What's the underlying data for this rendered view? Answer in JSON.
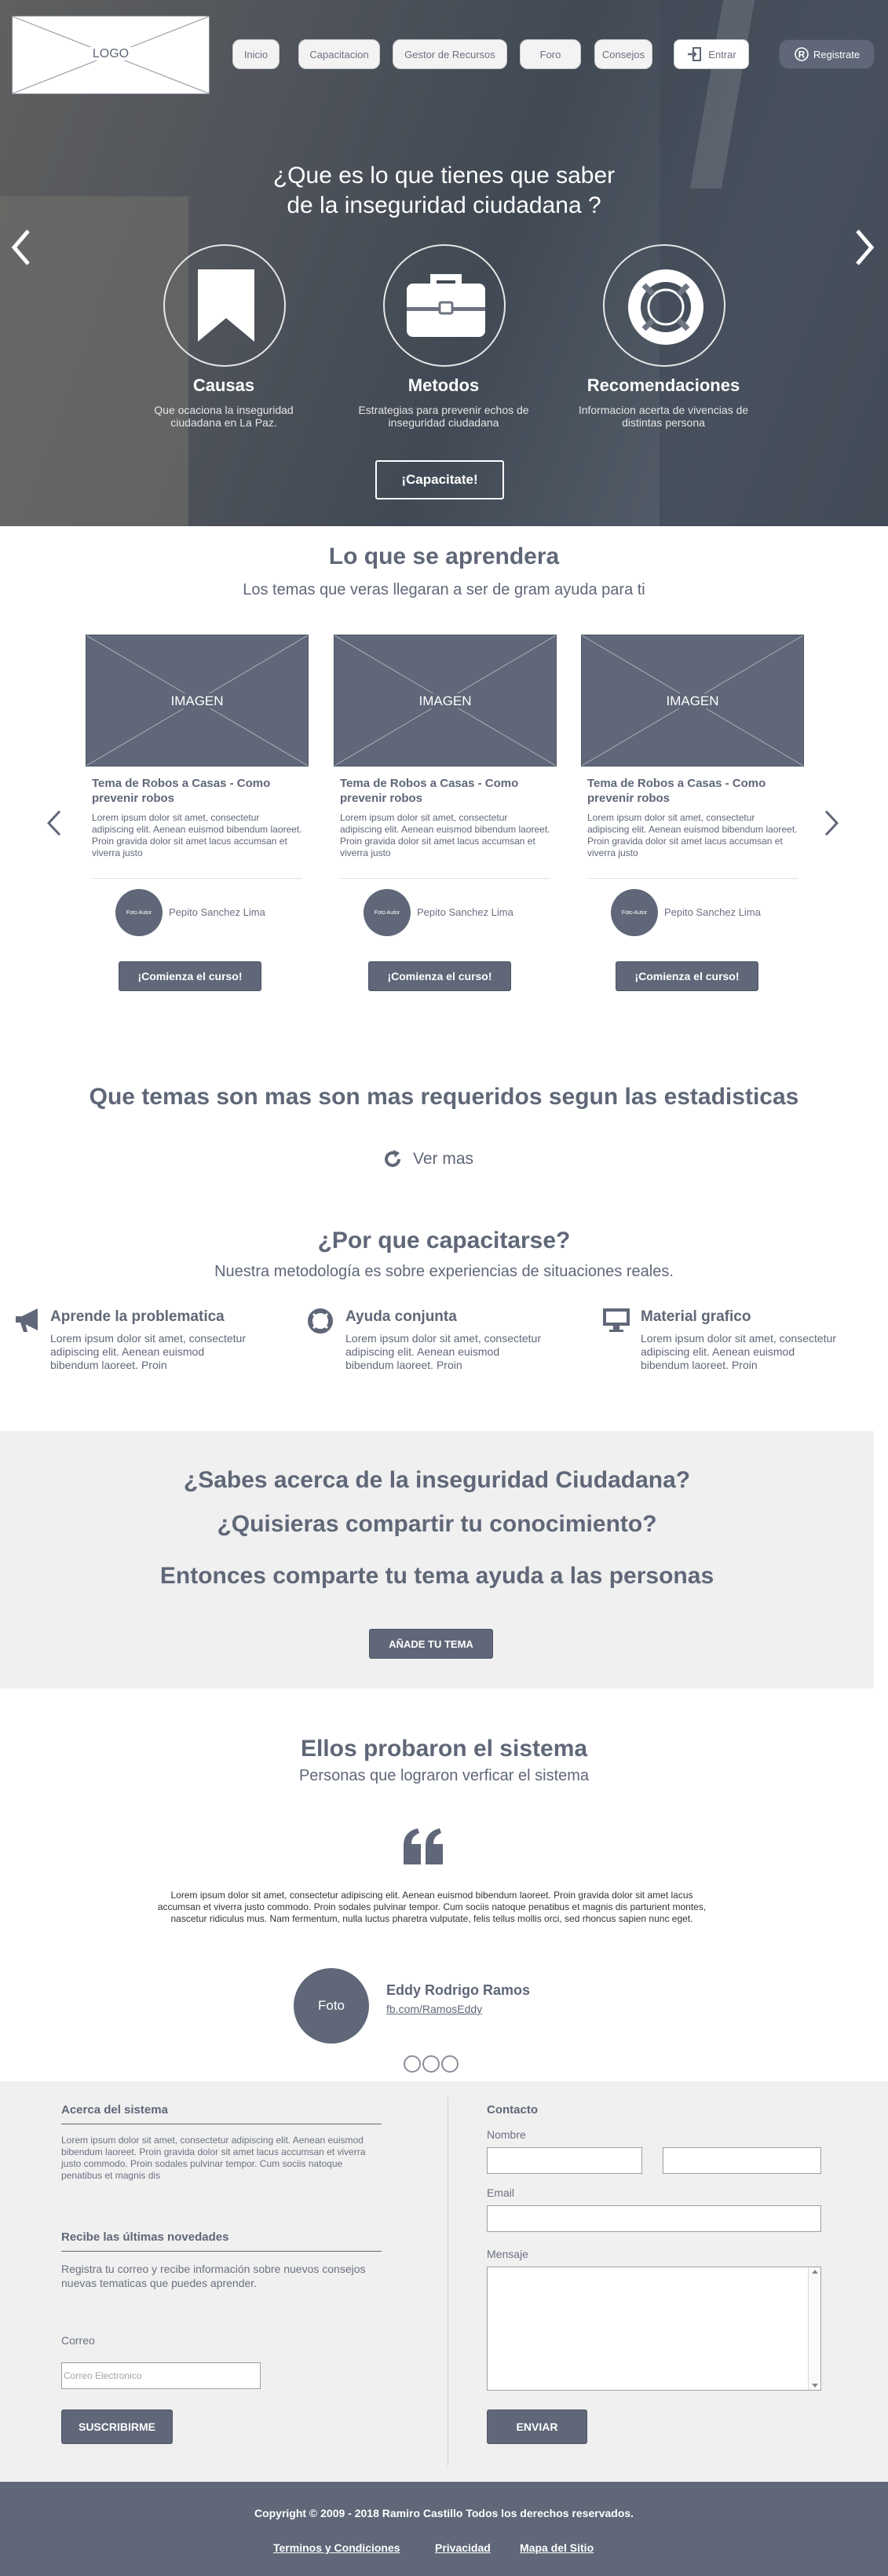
{
  "nav": {
    "logo": "LOGO",
    "items": [
      "Inicio",
      "Capacitacion",
      "Gestor de Recursos",
      "Foro",
      "Consejos"
    ],
    "login": "Entrar",
    "register": "Registrate"
  },
  "hero": {
    "title_line1": "¿Que es lo que tienes que saber",
    "title_line2": "de la inseguridad ciudadana ?",
    "features": [
      {
        "title": "Causas",
        "text": "Que ocaciona la inseguridad ciudadana en La Paz.",
        "icon": "bookmark-icon"
      },
      {
        "title": "Metodos",
        "text": "Estrategias para prevenir echos de inseguridad ciudadana",
        "icon": "briefcase-icon"
      },
      {
        "title": "Recomendaciones",
        "text": "Informacion acerta de vivencias de distintas persona",
        "icon": "lifebuoy-icon"
      }
    ],
    "cta": "¡Capacitate!"
  },
  "learn": {
    "title": "Lo que se aprendera",
    "subtitle": "Los temas que veras  llegaran a ser de gram ayuda para ti",
    "cards": [
      {
        "image": "IMAGEN",
        "title": "Tema de Robos a Casas - Como prevenir robos",
        "text": "Lorem ipsum dolor sit amet, consectetur adipiscing elit. Aenean euismod bibendum laoreet. Proin gravida dolor sit amet lacus accumsan et viverra justo",
        "avatar": "Foto Autor",
        "author": "Pepito Sanchez Lima",
        "button": "¡Comienza el curso!"
      },
      {
        "image": "IMAGEN",
        "title": "Tema de Robos a Casas - Como prevenir robos",
        "text": "Lorem ipsum dolor sit amet, consectetur adipiscing elit. Aenean euismod bibendum laoreet. Proin gravida dolor sit amet lacus accumsan et viverra justo",
        "avatar": "Foto Autor",
        "author": "Pepito Sanchez Lima",
        "button": "¡Comienza el curso!"
      },
      {
        "image": "IMAGEN",
        "title": "Tema de Robos a Casas - Como prevenir robos",
        "text": "Lorem ipsum dolor sit amet, consectetur adipiscing elit. Aenean euismod bibendum laoreet. Proin gravida dolor sit amet lacus accumsan et viverra justo",
        "avatar": "Foto Autor",
        "author": "Pepito Sanchez Lima",
        "button": "¡Comienza el curso!"
      }
    ]
  },
  "stats": {
    "title": "Que temas son mas son  mas requeridos segun las estadisticas",
    "more": "Ver mas"
  },
  "why": {
    "title": "¿Por que capacitarse?",
    "subtitle": "Nuestra metodología es sobre experiencias de situaciones reales.",
    "items": [
      {
        "title": "Aprende la problematica",
        "text": "Lorem ipsum dolor sit amet, consectetur adipiscing elit. Aenean euismod bibendum laoreet. Proin",
        "icon": "megaphone-icon"
      },
      {
        "title": "Ayuda conjunta",
        "text": "Lorem ipsum dolor sit amet, consectetur adipiscing elit. Aenean euismod bibendum laoreet. Proin",
        "icon": "lifebuoy-icon"
      },
      {
        "title": "Material grafico",
        "text": "Lorem ipsum dolor sit amet, consectetur adipiscing elit. Aenean euismod bibendum laoreet. Proin",
        "icon": "monitor-icon"
      }
    ]
  },
  "share": {
    "line1": "¿Sabes acerca de la inseguridad Ciudadana?",
    "line2": "¿Quisieras compartir tu conocimiento?",
    "line3": "Entonces comparte tu tema ayuda a las personas",
    "button": "AÑADE TU TEMA"
  },
  "testimonials": {
    "title": "Ellos probaron el sistema",
    "subtitle": "Personas que lograron verficar el sistema",
    "quote": "Lorem ipsum dolor sit amet, consectetur adipiscing elit. Aenean euismod bibendum laoreet. Proin gravida dolor sit amet lacus accumsan et viverra justo commodo. Proin sodales pulvinar tempor. Cum sociis natoque penatibus et magnis dis parturient montes, nascetur ridiculus mus. Nam fermentum, nulla luctus pharetra vulputate, felis tellus mollis orci, sed rhoncus sapien nunc eget.",
    "photo": "Foto",
    "name": "Eddy Rodrigo Ramos",
    "link": "fb.com/RamosEddy"
  },
  "footer": {
    "about_title": "Acerca del sistema",
    "about_text": "Lorem ipsum dolor sit amet, consectetur adipiscing elit. Aenean euismod bibendum laoreet. Proin gravida dolor sit amet lacus accumsan et viverra justo commodo. Proin sodales pulvinar tempor. Cum sociis natoque penatibus et magnis dis",
    "news_title": "Recibe las últimas novedades",
    "news_text": "Registra tu correo y recibe información sobre nuevos consejos nuevas tematicas que puedes aprender.",
    "email_label": "Correo",
    "email_placeholder": "Correo Electronico",
    "subscribe": "SUSCRIBIRME",
    "contact_title": "Contacto",
    "name_label": "Nombre",
    "email2_label": "Email",
    "message_label": "Mensaje",
    "send": "ENVIAR",
    "copyright": "Copyright © 2009 - 2018 Ramiro Castillo Todos los derechos reservados.",
    "links": [
      "Terminos y  Condiciones",
      "Privacidad",
      "Mapa del Sitio"
    ]
  },
  "colors": {
    "primary": "#5f6778",
    "light_bg": "#f0f0f0",
    "footer_bg": "#5f6778"
  }
}
